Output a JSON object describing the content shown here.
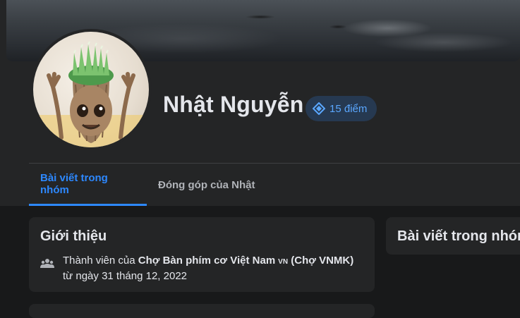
{
  "profile": {
    "name": "Nhật Nguyễn",
    "points_label": "15 điểm"
  },
  "tabs": [
    {
      "label": "Bài viết trong nhóm",
      "active": true
    },
    {
      "label": "Đóng góp của Nhật",
      "active": false
    }
  ],
  "intro": {
    "title": "Giới thiệu",
    "member_prefix": "Thành viên của ",
    "group_name": "Chợ Bàn phím cơ Việt Nam",
    "group_flag": "VN",
    "group_short": "(Chợ VNMK)",
    "member_suffix": " từ ngày 31 tháng 12, 2022"
  },
  "posts_panel": {
    "title": "Bài viết trong nhóm"
  },
  "icons": {
    "points": "diamond-badge-icon",
    "members": "group-icon"
  },
  "colors": {
    "accent": "#2d88ff",
    "badge_bg": "#263951",
    "badge_text": "#5aa7ff",
    "panel": "#242526",
    "page": "#18191a",
    "text": "#e4e6eb",
    "muted": "#b0b3b8"
  }
}
